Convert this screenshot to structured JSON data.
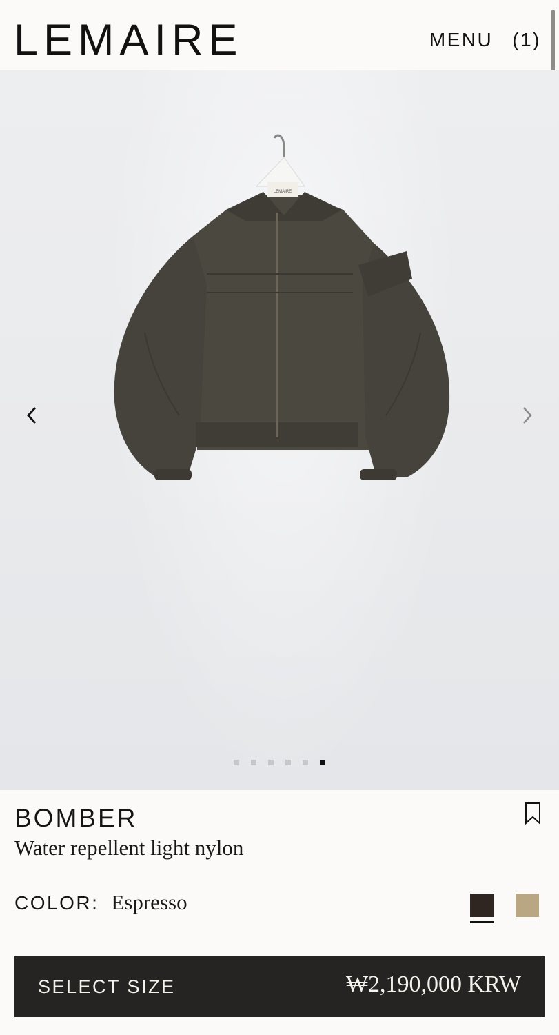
{
  "header": {
    "logo": "LEMAIRE",
    "menu_label": "MENU",
    "cart_label": "(1)"
  },
  "gallery": {
    "image_count": 6,
    "active_index": 5,
    "prev_icon": "chevron-left-icon",
    "next_icon": "chevron-right-icon",
    "jacket_tag": "LEMAIRE"
  },
  "product": {
    "title": "BOMBER",
    "subtitle": "Water repellent light nylon",
    "bookmark_icon": "bookmark-icon",
    "color_label": "COLOR:",
    "color_value": "Espresso",
    "swatches": [
      {
        "name": "Espresso",
        "hex": "#2f2622",
        "selected": true
      },
      {
        "name": "Sand",
        "hex": "#b9a784",
        "selected": false
      }
    ]
  },
  "cta": {
    "label": "SELECT SIZE",
    "price": "₩2,190,000 KRW"
  }
}
